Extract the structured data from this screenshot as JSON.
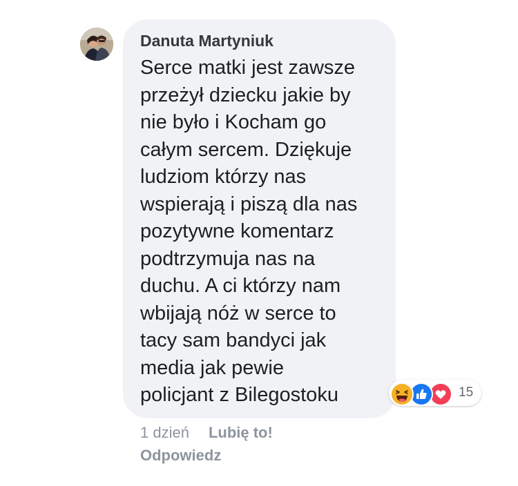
{
  "comment": {
    "author": "Danuta Martyniuk",
    "text_lines": [
      "Serce matki jest zawsze",
      "przeżył dziecku jakie by",
      "nie było i Kocham go",
      "całym sercem. Dziękuje",
      "ludziom którzy nas",
      "wspierają i piszą dla nas",
      "pozytywne komentarz",
      "podtrzymuja nas na",
      "duchu. A ci którzy nam",
      "wbijają nóż w serce to",
      "tacy sam bandyci jak",
      "media jak pewie",
      "policjant z Bilegostoku"
    ],
    "reactions": {
      "icons": [
        "haha-icon",
        "like-icon",
        "love-icon"
      ],
      "count": "15"
    },
    "timestamp": "1 dzień",
    "like_label": "Lubię to!",
    "reply_label": "Odpowiedz"
  },
  "colors": {
    "bubble_bg": "#f1f2f6",
    "author": "#35373c",
    "text": "#1c1e21",
    "meta": "#8d949e",
    "like_blue": "#1877f2",
    "love_red": "#f33e58",
    "haha_yellow": "#f7b125"
  }
}
